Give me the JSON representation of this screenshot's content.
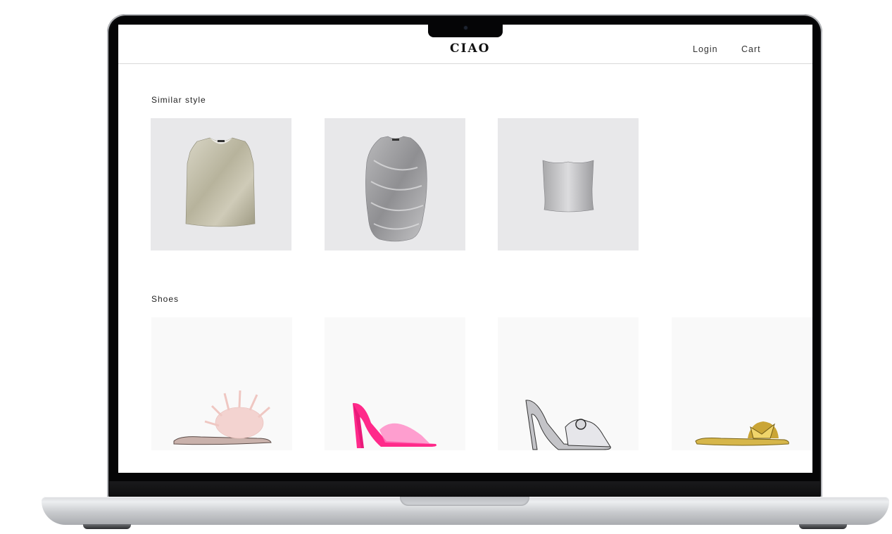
{
  "brand": {
    "logo": "CIAO"
  },
  "nav": {
    "login": "Login",
    "cart": "Cart"
  },
  "sections": {
    "similar": {
      "title": "Similar style",
      "items": [
        {
          "icon": "metallic-gold-tank-top"
        },
        {
          "icon": "silver-sequin-draped-top"
        },
        {
          "icon": "silver-strapless-bandeau-top"
        }
      ]
    },
    "shoes": {
      "title": "Shoes",
      "items": [
        {
          "icon": "pink-feather-slide-sandal"
        },
        {
          "icon": "pink-vinyl-heeled-mule"
        },
        {
          "icon": "silver-bow-heeled-mule"
        },
        {
          "icon": "gold-bow-flat-slide"
        }
      ]
    }
  },
  "colors": {
    "accent_pink": "#ff2a8a",
    "text": "#222222",
    "divider": "#d9d9d9"
  }
}
